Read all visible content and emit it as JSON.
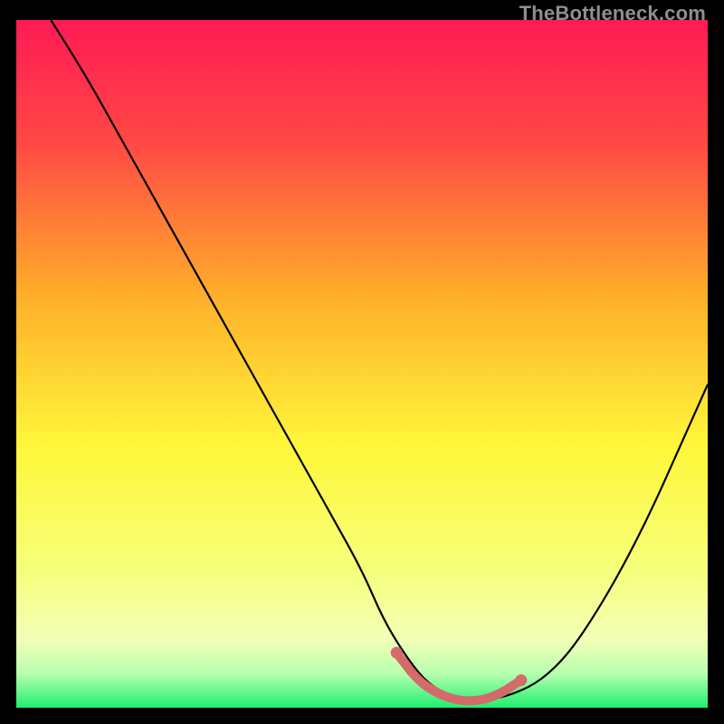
{
  "watermark": "TheBottleneck.com",
  "colors": {
    "bg": "#000000",
    "gradient_top": "#ff1a55",
    "gradient_mid1": "#ffae2a",
    "gradient_mid2": "#fff73a",
    "gradient_low": "#f3ffb6",
    "gradient_bottom": "#1fef6f",
    "curve": "#000000",
    "marker": "#d46a6a"
  },
  "chart_data": {
    "type": "line",
    "title": "",
    "xlabel": "",
    "ylabel": "",
    "xlim": [
      0,
      100
    ],
    "ylim": [
      0,
      100
    ],
    "grid": false,
    "legend": false,
    "series": [
      {
        "name": "bottleneck-curve",
        "x": [
          5,
          10,
          15,
          20,
          25,
          30,
          35,
          40,
          45,
          50,
          53,
          56,
          59,
          62,
          65,
          68,
          72,
          76,
          80,
          84,
          88,
          92,
          96,
          100
        ],
        "y": [
          100,
          92,
          83,
          74,
          65,
          56,
          47,
          38,
          29,
          20,
          13,
          8,
          4,
          2,
          1,
          1,
          2,
          4,
          8,
          14,
          21,
          29,
          38,
          47
        ]
      }
    ],
    "highlight": {
      "name": "optimal-range",
      "x": [
        55,
        58,
        61,
        64,
        67,
        70,
        73
      ],
      "y": [
        8,
        4,
        2,
        1,
        1,
        2,
        4
      ]
    },
    "background_gradient_meaning": "color encodes bottleneck severity: red high, green low"
  }
}
